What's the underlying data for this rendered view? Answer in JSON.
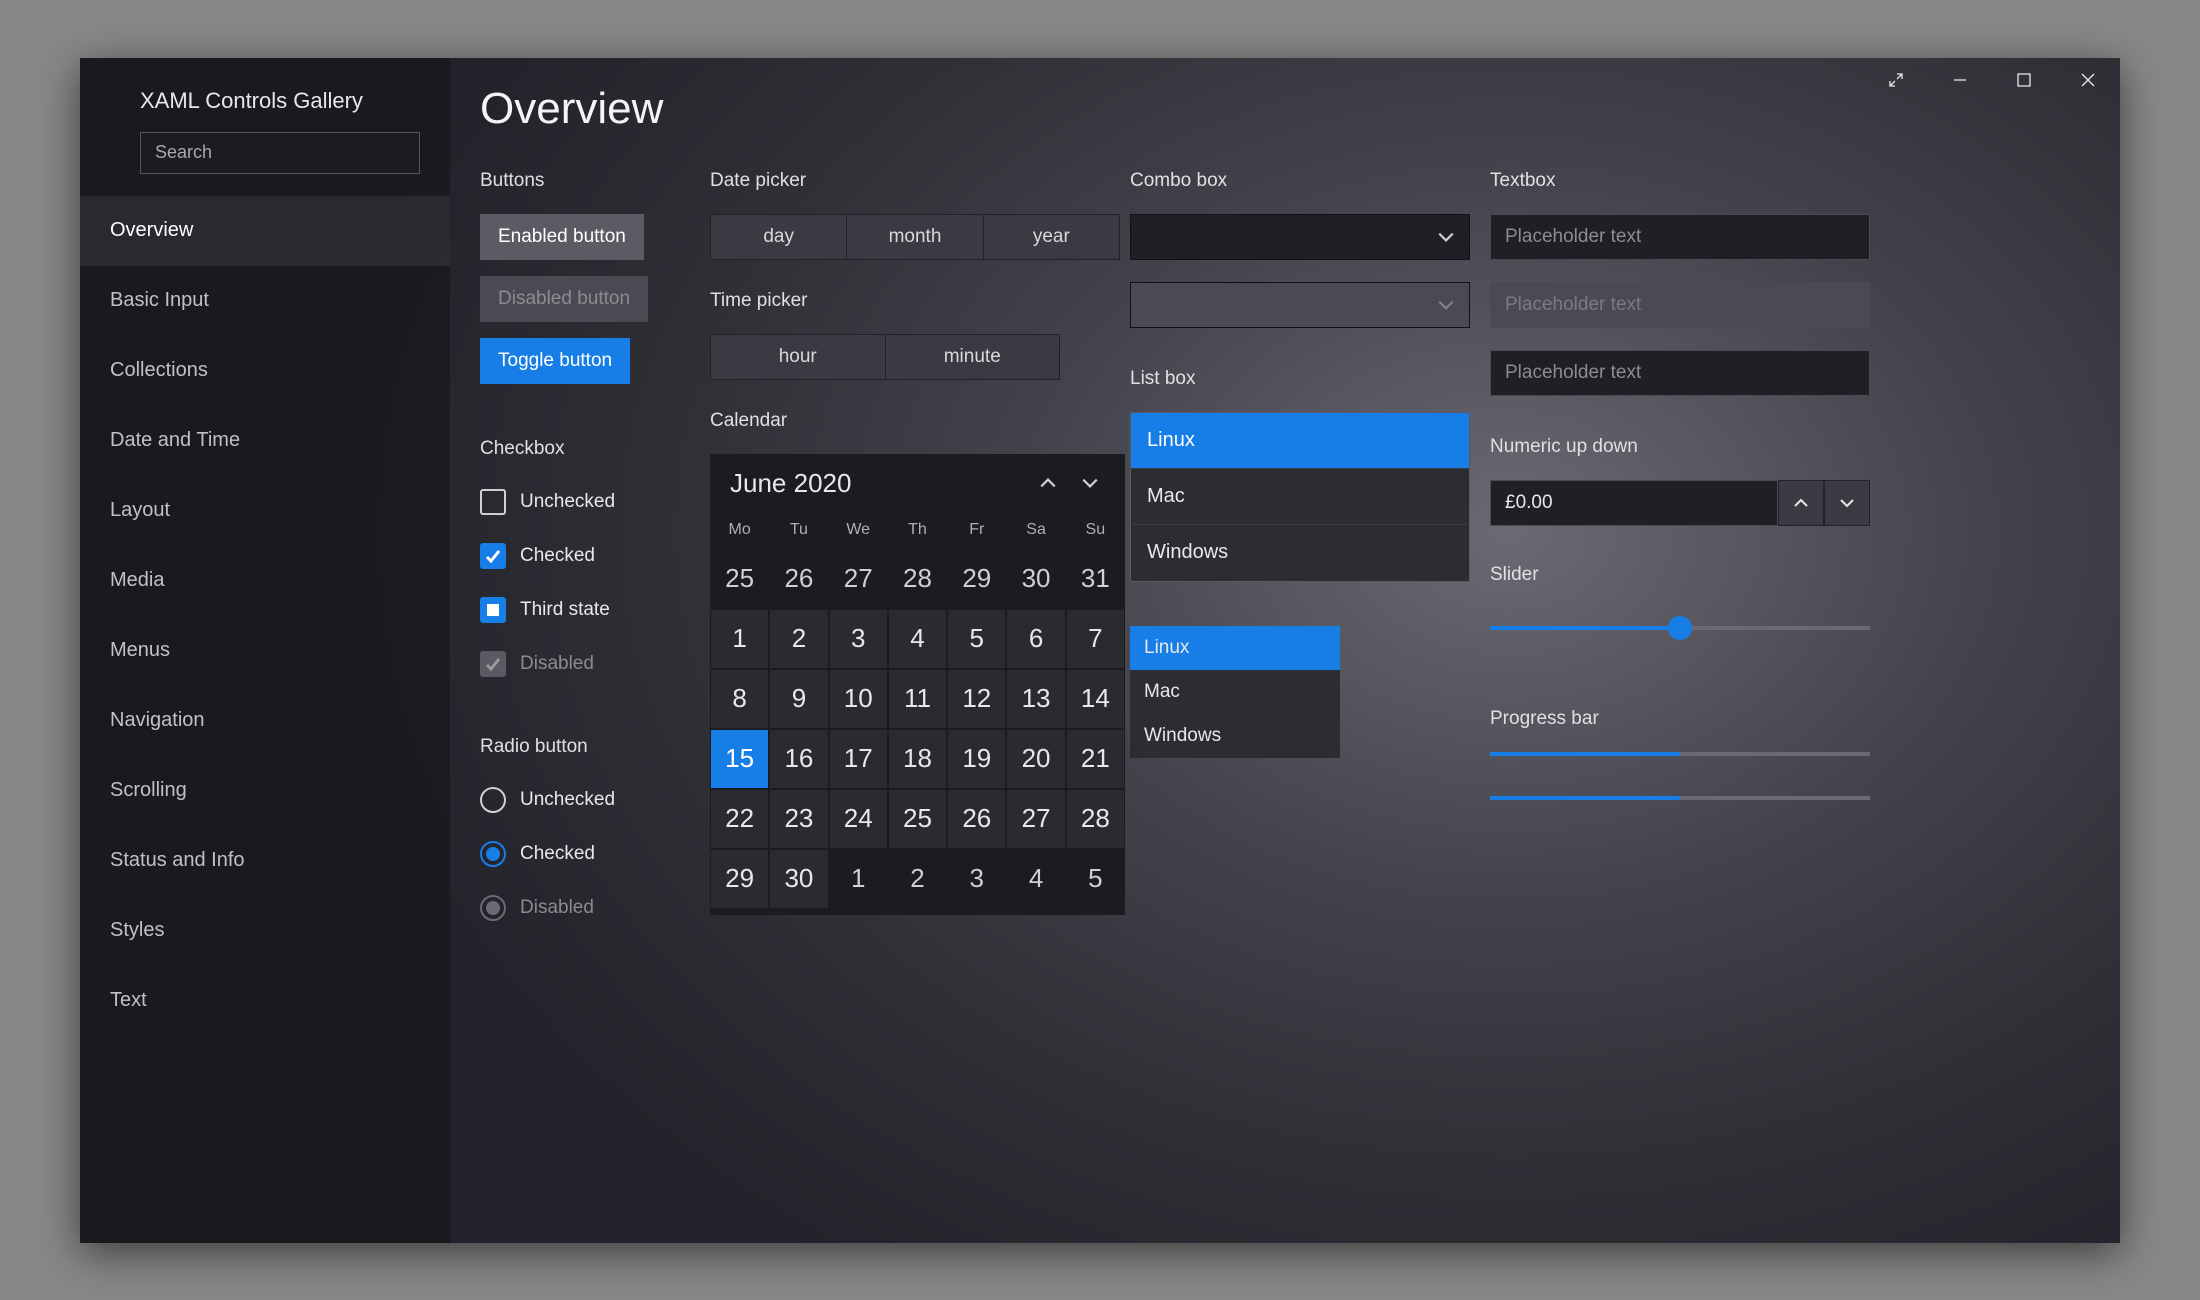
{
  "app": {
    "title": "XAML Controls Gallery",
    "search_placeholder": "Search"
  },
  "sidebar": {
    "items": [
      {
        "label": "Overview",
        "active": true
      },
      {
        "label": "Basic Input"
      },
      {
        "label": "Collections"
      },
      {
        "label": "Date and Time"
      },
      {
        "label": "Layout"
      },
      {
        "label": "Media"
      },
      {
        "label": "Menus"
      },
      {
        "label": "Navigation"
      },
      {
        "label": "Scrolling"
      },
      {
        "label": "Status and Info"
      },
      {
        "label": "Styles"
      },
      {
        "label": "Text"
      }
    ]
  },
  "page": {
    "title": "Overview"
  },
  "buttons": {
    "section": "Buttons",
    "enabled": "Enabled button",
    "disabled": "Disabled button",
    "toggle": "Toggle button"
  },
  "checkbox": {
    "section": "Checkbox",
    "unchecked": "Unchecked",
    "checked": "Checked",
    "third": "Third state",
    "disabled": "Disabled"
  },
  "radio": {
    "section": "Radio button",
    "unchecked": "Unchecked",
    "checked": "Checked",
    "disabled": "Disabled"
  },
  "datepicker": {
    "section": "Date picker",
    "day": "day",
    "month": "month",
    "year": "year"
  },
  "timepicker": {
    "section": "Time picker",
    "hour": "hour",
    "minute": "minute"
  },
  "calendar": {
    "section": "Calendar",
    "title": "June 2020",
    "dow": [
      "Mo",
      "Tu",
      "We",
      "Th",
      "Fr",
      "Sa",
      "Su"
    ],
    "selected": 15,
    "leading": [
      25,
      26,
      27,
      28,
      29,
      30,
      31
    ],
    "days": [
      1,
      2,
      3,
      4,
      5,
      6,
      7,
      8,
      9,
      10,
      11,
      12,
      13,
      14,
      15,
      16,
      17,
      18,
      19,
      20,
      21,
      22,
      23,
      24,
      25,
      26,
      27,
      28
    ],
    "trailing_row": [
      29,
      30,
      1,
      2,
      3,
      4,
      5
    ],
    "trailing_other_from_index": 2
  },
  "combo": {
    "section": "Combo box"
  },
  "listbox": {
    "section": "List box",
    "items": [
      "Linux",
      "Mac",
      "Windows"
    ],
    "selected": "Linux"
  },
  "listbox2": {
    "items": [
      "Linux",
      "Mac",
      "Windows"
    ],
    "selected": "Linux"
  },
  "textbox": {
    "section": "Textbox",
    "placeholder": "Placeholder text"
  },
  "numeric": {
    "section": "Numeric up down",
    "value": "£0.00"
  },
  "slider": {
    "section": "Slider",
    "value_pct": 50
  },
  "progress": {
    "section": "Progress bar",
    "values_pct": [
      50,
      50
    ]
  }
}
